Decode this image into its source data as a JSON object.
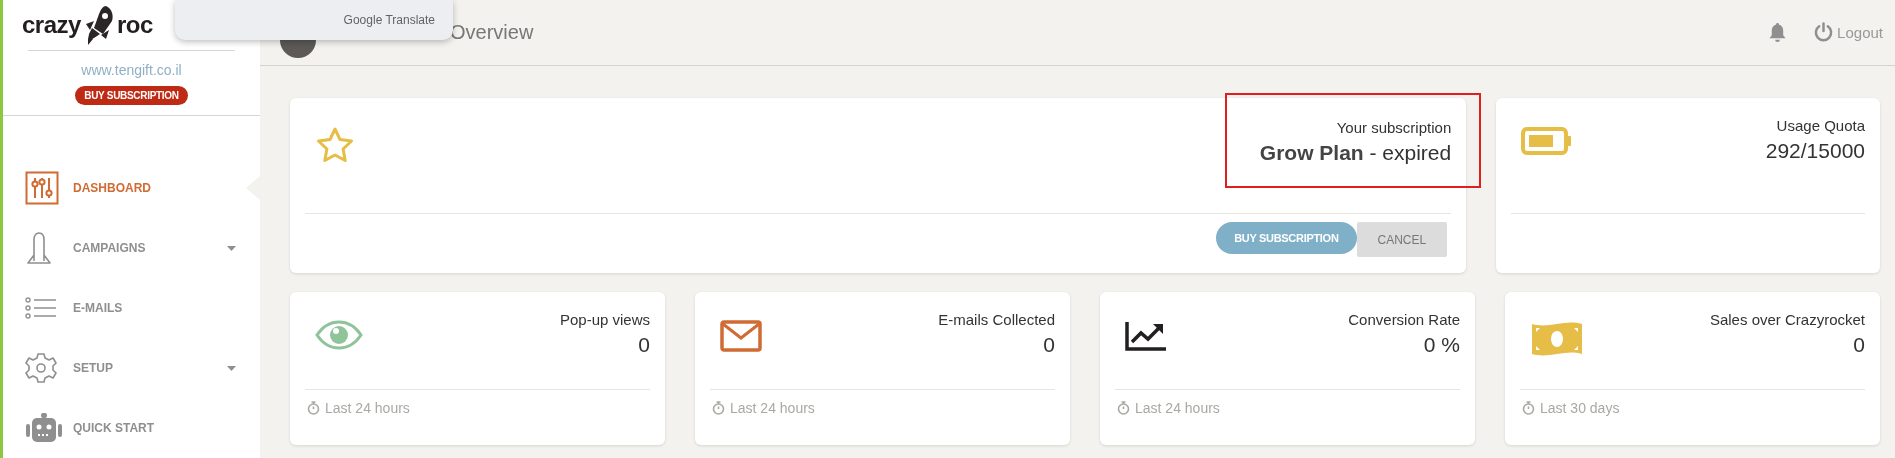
{
  "sidebar": {
    "logo": {
      "before": "crazy",
      "after": "roc"
    },
    "site": "www.tengift.co.il",
    "buy_button": "BUY SUBSCRIPTION",
    "items": [
      {
        "kind": "dashboard",
        "label": "DASHBOARD",
        "selected": true,
        "submenu": false
      },
      {
        "kind": "campaigns",
        "label": "CAMPAIGNS",
        "selected": false,
        "submenu": true
      },
      {
        "kind": "emails",
        "label": "E-MAILS",
        "selected": false,
        "submenu": false
      },
      {
        "kind": "setup",
        "label": "SETUP",
        "selected": false,
        "submenu": true
      },
      {
        "kind": "quickstart",
        "label": "QUICK START",
        "selected": false,
        "submenu": false
      }
    ]
  },
  "translate_popup": {
    "text": "Google Translate"
  },
  "header": {
    "title": "Overview",
    "logout": "Logout"
  },
  "subscription": {
    "label": "Your subscription",
    "plan": "**Grow Plan** - expired",
    "highlighted": true,
    "buttons": [
      {
        "kind": "primary",
        "label": "BUY SUBSCRIPTION"
      },
      {
        "kind": "secondary",
        "label": "CANCEL"
      }
    ]
  },
  "quota": {
    "label": "Usage Quota",
    "value": "292/15000"
  },
  "stats": [
    {
      "kind": "views",
      "label": "Pop-up views",
      "value": "0",
      "period": "Last 24 hours"
    },
    {
      "kind": "emails",
      "label": "E-mails Collected",
      "value": "0",
      "period": "Last 24 hours"
    },
    {
      "kind": "conversion",
      "label": "Conversion Rate",
      "value": "0 %",
      "period": "Last 24 hours"
    },
    {
      "kind": "sales",
      "label": "Sales over Crazyrocket",
      "value": "0",
      "period": "Last 30 days"
    }
  ]
}
